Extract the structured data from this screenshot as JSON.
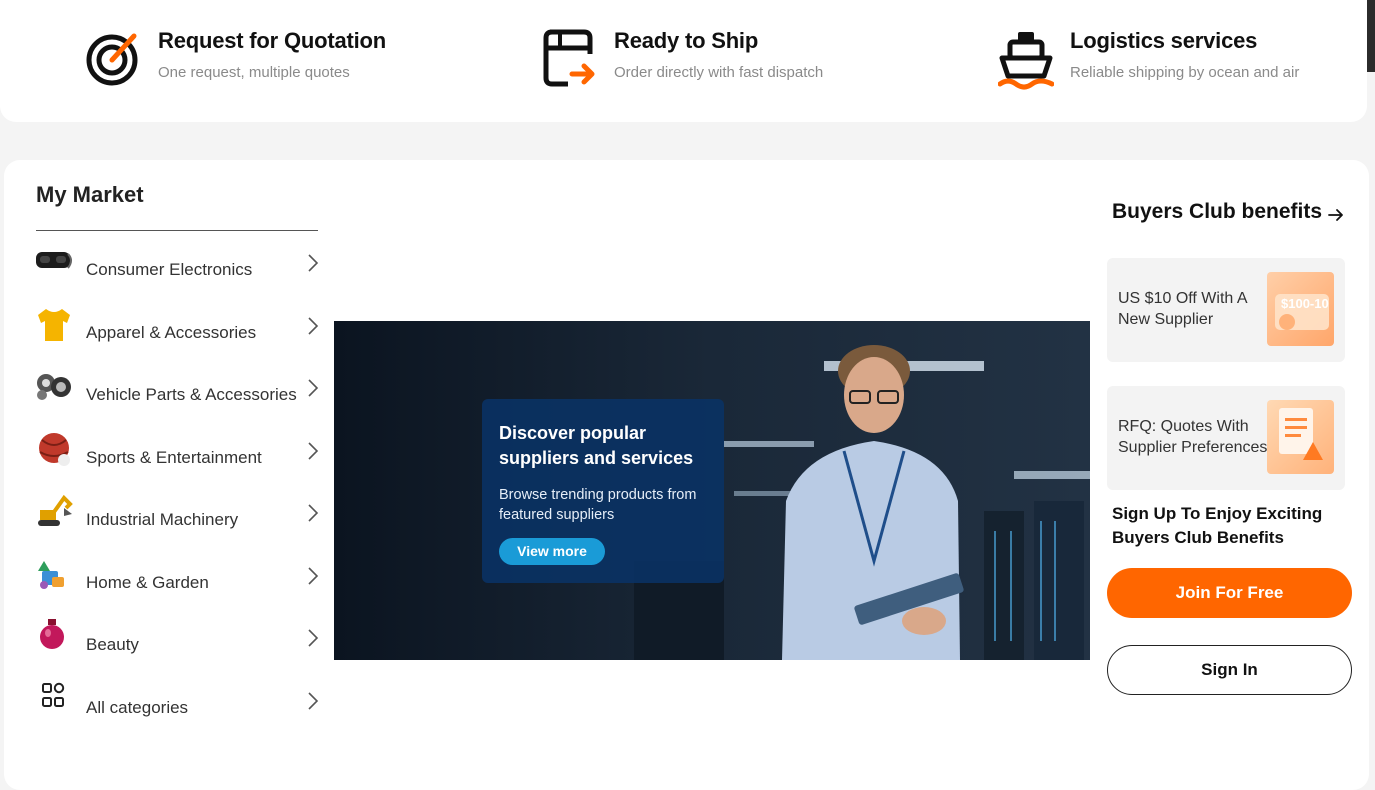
{
  "services": [
    {
      "icon": "target-icon",
      "title": "Request for Quotation",
      "subtitle": "One request, multiple quotes"
    },
    {
      "icon": "box-arrow-icon",
      "title": "Ready to Ship",
      "subtitle": "Order directly with fast dispatch"
    },
    {
      "icon": "ship-icon",
      "title": "Logistics services",
      "subtitle": "Reliable shipping by ocean and air"
    }
  ],
  "market": {
    "title": "My Market",
    "categories": [
      {
        "label": "Consumer Electronics",
        "icon": "vr-headset-icon"
      },
      {
        "label": "Apparel & Accessories",
        "icon": "tshirt-icon"
      },
      {
        "label": "Vehicle Parts & Accessories",
        "icon": "car-parts-icon"
      },
      {
        "label": "Sports & Entertainment",
        "icon": "sports-ball-icon"
      },
      {
        "label": "Industrial Machinery",
        "icon": "excavator-icon"
      },
      {
        "label": "Home & Garden",
        "icon": "home-garden-icon"
      },
      {
        "label": "Beauty",
        "icon": "perfume-icon"
      },
      {
        "label": "All categories",
        "icon": "grid-icon"
      }
    ]
  },
  "banner": {
    "heading": "Discover popular suppliers and services",
    "text": "Browse trending products from featured suppliers",
    "button": "View more"
  },
  "club": {
    "title": "Buyers Club benefits",
    "benefits": [
      {
        "text": "US $10 Off With A New Supplier",
        "image_label": "$100-10"
      },
      {
        "text": "RFQ: Quotes With Supplier Preferences"
      }
    ],
    "cta": "Sign Up To Enjoy Exciting Buyers Club Benefits",
    "join": "Join For Free",
    "signin": "Sign In"
  },
  "colors": {
    "accent": "#ff6600",
    "banner_button": "#1a9bd7"
  }
}
